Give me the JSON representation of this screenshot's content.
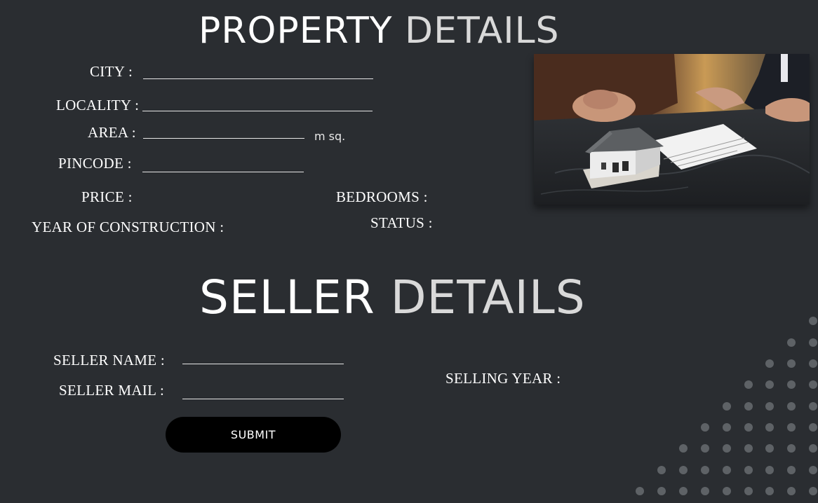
{
  "property": {
    "title_word1": "PROPERTY",
    "title_word2": "DETAILS",
    "city_label": "CITY  :",
    "locality_label": "LOCALITY :",
    "area_label": "AREA :",
    "area_unit": "m sq.",
    "pincode_label": "PINCODE :",
    "price_label": "PRICE :",
    "bedrooms_label": "BEDROOMS  :",
    "year_label": "YEAR OF CONSTRUCTION :",
    "status_label": "STATUS  :"
  },
  "seller": {
    "title_word1": "SELLER",
    "title_word2": "DETAILS",
    "name_label": "SELLER NAME :",
    "mail_label": "SELLER MAIL :",
    "selling_year_label": "SELLING YEAR :"
  },
  "submit_label": "SUBMIT",
  "colors": {
    "background": "#2a2d31",
    "title_accent": "#d9d9d9",
    "dots": "#5e6266",
    "button": "#000000"
  },
  "image": {
    "name": "house-model-on-desk-photo"
  }
}
